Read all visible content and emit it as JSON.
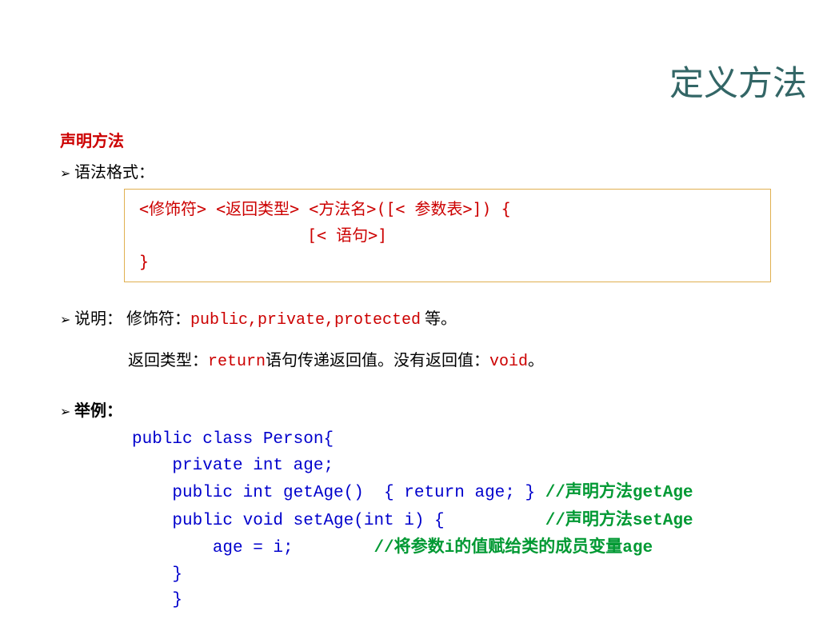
{
  "title": "定义方法",
  "section_header": "声明方法",
  "syntax": {
    "label_prefix": "语法格式：",
    "line1": "<修饰符> <返回类型> <方法名>([< 参数表>]) {",
    "line2": "[< 语句>]",
    "line3": "}"
  },
  "description": {
    "label": "说明：",
    "modifier_label": " 修饰符：",
    "modifier_values": "public,private,protected",
    "modifier_suffix": " 等。",
    "return_label": "返回类型：",
    "return_keyword": "return",
    "return_mid": "语句传递返回值。没有返回值：",
    "void_keyword": "void",
    "return_suffix": "。"
  },
  "example": {
    "label": "举例：",
    "code": {
      "l1": "public class Person{",
      "l2_pre": "    private int age;",
      "l3_pre": "    public int getAge()  { return age; } ",
      "l3_cmt_prefix": "//",
      "l3_cmt_cn": "声明方法",
      "l3_cmt_en": "getAge",
      "l4_pre": "    public void setAge(int i) {          ",
      "l4_cmt_prefix": "//",
      "l4_cmt_cn": "声明方法",
      "l4_cmt_en": "setAge",
      "l5_pre": "        age = i;        ",
      "l5_cmt_prefix": "//",
      "l5_cmt_cn1": "将参数",
      "l5_cmt_en1": "i",
      "l5_cmt_cn2": "的值赋给类的成员变量",
      "l5_cmt_en2": "age",
      "l6": "    }",
      "l7": "    }"
    }
  },
  "bullet": "➢"
}
